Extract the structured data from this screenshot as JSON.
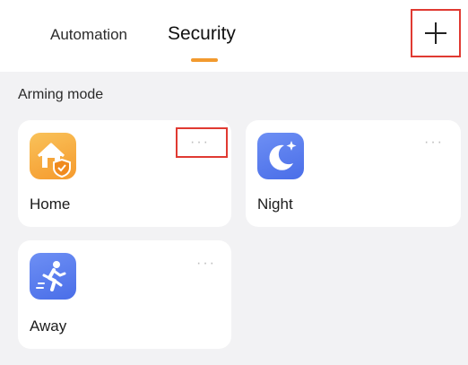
{
  "tabs": [
    {
      "label": "Automation",
      "active": false
    },
    {
      "label": "Security",
      "active": true
    }
  ],
  "colors": {
    "accent": "#f29a2e",
    "highlight_box": "#e03a32",
    "home_icon_bg": "#f5a53a",
    "mode_icon_bg": "#5a7df0"
  },
  "add_button": {
    "icon": "plus-icon"
  },
  "section": {
    "title": "Arming mode"
  },
  "modes": [
    {
      "label": "Home",
      "icon": "home-shield-icon",
      "more": "···"
    },
    {
      "label": "Night",
      "icon": "moon-icon",
      "more": "···"
    },
    {
      "label": "Away",
      "icon": "running-person-icon",
      "more": "···"
    }
  ]
}
